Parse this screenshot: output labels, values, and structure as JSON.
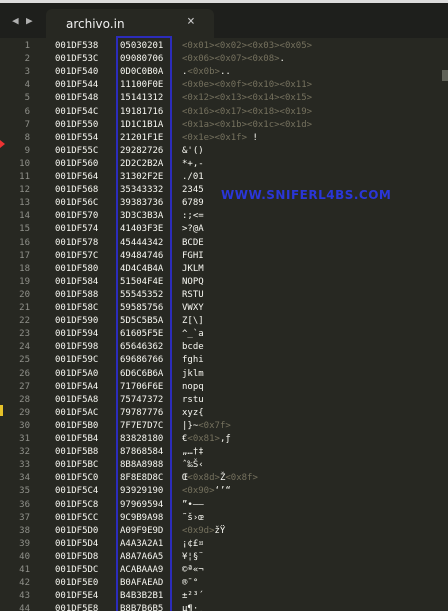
{
  "nav": {
    "back": "◀",
    "forward": "▶"
  },
  "tab": {
    "title": "archivo.in",
    "close": "×"
  },
  "watermark": "WWW.SNIFERL4BS.COM",
  "colors": {
    "background": "#272822",
    "hexBox": "#2c2cbb",
    "watermark": "#2a36d8",
    "breakpoint": "#e33333",
    "modifiedMarker": "#e6c229"
  },
  "rows": [
    {
      "ln": "1",
      "addr": "001DF538",
      "hex": "05030201",
      "text": [
        {
          "t": "<0x01><0x02><0x03><0x05>",
          "ctl": true
        }
      ]
    },
    {
      "ln": "2",
      "addr": "001DF53C",
      "hex": "09080706",
      "text": [
        {
          "t": "<0x06><0x07><0x08>",
          "ctl": true
        },
        {
          "t": ".",
          "ctl": false
        }
      ]
    },
    {
      "ln": "3",
      "addr": "001DF540",
      "hex": "0D0C0B0A",
      "text": [
        {
          "t": ".",
          "ctl": false
        },
        {
          "t": "<0x0b>",
          "ctl": true
        },
        {
          "t": "..",
          "ctl": false
        }
      ]
    },
    {
      "ln": "4",
      "addr": "001DF544",
      "hex": "11100F0E",
      "text": [
        {
          "t": "<0x0e><0x0f><0x10><0x11>",
          "ctl": true
        }
      ]
    },
    {
      "ln": "5",
      "addr": "001DF548",
      "hex": "15141312",
      "text": [
        {
          "t": "<0x12><0x13><0x14><0x15>",
          "ctl": true
        }
      ]
    },
    {
      "ln": "6",
      "addr": "001DF54C",
      "hex": "19181716",
      "text": [
        {
          "t": "<0x16><0x17><0x18><0x19>",
          "ctl": true
        }
      ]
    },
    {
      "ln": "7",
      "addr": "001DF550",
      "hex": "1D1C1B1A",
      "text": [
        {
          "t": "<0x1a><0x1b><0x1c><0x1d>",
          "ctl": true
        }
      ]
    },
    {
      "ln": "8",
      "addr": "001DF554",
      "hex": "21201F1E",
      "text": [
        {
          "t": "<0x1e><0x1f>",
          "ctl": true
        },
        {
          "t": " !",
          "ctl": false
        }
      ]
    },
    {
      "ln": "9",
      "addr": "001DF55C",
      "hex": "29282726",
      "text": [
        {
          "t": "&'()",
          "ctl": false
        }
      ]
    },
    {
      "ln": "10",
      "addr": "001DF560",
      "hex": "2D2C2B2A",
      "text": [
        {
          "t": "*+,-",
          "ctl": false
        }
      ]
    },
    {
      "ln": "11",
      "addr": "001DF564",
      "hex": "31302F2E",
      "text": [
        {
          "t": "./01",
          "ctl": false
        }
      ]
    },
    {
      "ln": "12",
      "addr": "001DF568",
      "hex": "35343332",
      "text": [
        {
          "t": "2345",
          "ctl": false
        }
      ]
    },
    {
      "ln": "13",
      "addr": "001DF56C",
      "hex": "39383736",
      "text": [
        {
          "t": "6789",
          "ctl": false
        }
      ]
    },
    {
      "ln": "14",
      "addr": "001DF570",
      "hex": "3D3C3B3A",
      "text": [
        {
          "t": ":;<=",
          "ctl": false
        }
      ]
    },
    {
      "ln": "15",
      "addr": "001DF574",
      "hex": "41403F3E",
      "text": [
        {
          "t": ">?@A",
          "ctl": false
        }
      ]
    },
    {
      "ln": "16",
      "addr": "001DF578",
      "hex": "45444342",
      "text": [
        {
          "t": "BCDE",
          "ctl": false
        }
      ]
    },
    {
      "ln": "17",
      "addr": "001DF57C",
      "hex": "49484746",
      "text": [
        {
          "t": "FGHI",
          "ctl": false
        }
      ]
    },
    {
      "ln": "18",
      "addr": "001DF580",
      "hex": "4D4C4B4A",
      "text": [
        {
          "t": "JKLM",
          "ctl": false
        }
      ]
    },
    {
      "ln": "19",
      "addr": "001DF584",
      "hex": "51504F4E",
      "text": [
        {
          "t": "NOPQ",
          "ctl": false
        }
      ]
    },
    {
      "ln": "20",
      "addr": "001DF588",
      "hex": "55545352",
      "text": [
        {
          "t": "RSTU",
          "ctl": false
        }
      ]
    },
    {
      "ln": "21",
      "addr": "001DF58C",
      "hex": "59585756",
      "text": [
        {
          "t": "VWXY",
          "ctl": false
        }
      ]
    },
    {
      "ln": "22",
      "addr": "001DF590",
      "hex": "5D5C5B5A",
      "text": [
        {
          "t": "Z[\\]",
          "ctl": false
        }
      ]
    },
    {
      "ln": "23",
      "addr": "001DF594",
      "hex": "61605F5E",
      "text": [
        {
          "t": "^_`a",
          "ctl": false
        }
      ]
    },
    {
      "ln": "24",
      "addr": "001DF598",
      "hex": "65646362",
      "text": [
        {
          "t": "bcde",
          "ctl": false
        }
      ]
    },
    {
      "ln": "25",
      "addr": "001DF59C",
      "hex": "69686766",
      "text": [
        {
          "t": "fghi",
          "ctl": false
        }
      ]
    },
    {
      "ln": "26",
      "addr": "001DF5A0",
      "hex": "6D6C6B6A",
      "text": [
        {
          "t": "jklm",
          "ctl": false
        }
      ]
    },
    {
      "ln": "27",
      "addr": "001DF5A4",
      "hex": "71706F6E",
      "text": [
        {
          "t": "nopq",
          "ctl": false
        }
      ]
    },
    {
      "ln": "28",
      "addr": "001DF5A8",
      "hex": "75747372",
      "text": [
        {
          "t": "rstu",
          "ctl": false
        }
      ]
    },
    {
      "ln": "29",
      "addr": "001DF5AC",
      "hex": "79787776",
      "text": [
        {
          "t": "xyz{",
          "ctl": false
        }
      ]
    },
    {
      "ln": "30",
      "addr": "001DF5B0",
      "hex": "7F7E7D7C",
      "text": [
        {
          "t": "|}~",
          "ctl": false
        },
        {
          "t": "<0x7f>",
          "ctl": true
        }
      ]
    },
    {
      "ln": "31",
      "addr": "001DF5B4",
      "hex": "83828180",
      "text": [
        {
          "t": "€",
          "ctl": false
        },
        {
          "t": "<0x81>",
          "ctl": true
        },
        {
          "t": ",ƒ",
          "ctl": false
        }
      ]
    },
    {
      "ln": "32",
      "addr": "001DF5B8",
      "hex": "87868584",
      "text": [
        {
          "t": "„…†‡",
          "ctl": false
        }
      ]
    },
    {
      "ln": "33",
      "addr": "001DF5BC",
      "hex": "8B8A8988",
      "text": [
        {
          "t": "ˆ‰Š‹",
          "ctl": false
        }
      ]
    },
    {
      "ln": "34",
      "addr": "001DF5C0",
      "hex": "8F8E8D8C",
      "text": [
        {
          "t": "Œ",
          "ctl": false
        },
        {
          "t": "<0x8d>",
          "ctl": true
        },
        {
          "t": "Ž",
          "ctl": false
        },
        {
          "t": "<0x8f>",
          "ctl": true
        }
      ]
    },
    {
      "ln": "35",
      "addr": "001DF5C4",
      "hex": "93929190",
      "text": [
        {
          "t": "<0x90>",
          "ctl": true
        },
        {
          "t": "‘’“",
          "ctl": false
        }
      ]
    },
    {
      "ln": "36",
      "addr": "001DF5C8",
      "hex": "97969594",
      "text": [
        {
          "t": "”•–—",
          "ctl": false
        }
      ]
    },
    {
      "ln": "37",
      "addr": "001DF5CC",
      "hex": "9C9B9A98",
      "text": [
        {
          "t": "˜š›œ",
          "ctl": false
        }
      ]
    },
    {
      "ln": "38",
      "addr": "001DF5D0",
      "hex": "A09F9E9D",
      "text": [
        {
          "t": "<0x9d>",
          "ctl": true
        },
        {
          "t": "žŸ",
          "ctl": false
        }
      ]
    },
    {
      "ln": "39",
      "addr": "001DF5D4",
      "hex": "A4A3A2A1",
      "text": [
        {
          "t": "¡¢£¤",
          "ctl": false
        }
      ]
    },
    {
      "ln": "40",
      "addr": "001DF5D8",
      "hex": "A8A7A6A5",
      "text": [
        {
          "t": "¥¦§¨",
          "ctl": false
        }
      ]
    },
    {
      "ln": "41",
      "addr": "001DF5DC",
      "hex": "ACABAAA9",
      "text": [
        {
          "t": "©ª«¬",
          "ctl": false
        }
      ]
    },
    {
      "ln": "42",
      "addr": "001DF5E0",
      "hex": "B0AFAEAD",
      "text": [
        {
          "t": "®¯°",
          "ctl": false
        }
      ]
    },
    {
      "ln": "43",
      "addr": "001DF5E4",
      "hex": "B4B3B2B1",
      "text": [
        {
          "t": "±²³´",
          "ctl": false
        }
      ]
    },
    {
      "ln": "44",
      "addr": "001DF5E8",
      "hex": "B8B7B6B5",
      "text": [
        {
          "t": "µ¶·¸",
          "ctl": false
        }
      ]
    }
  ]
}
